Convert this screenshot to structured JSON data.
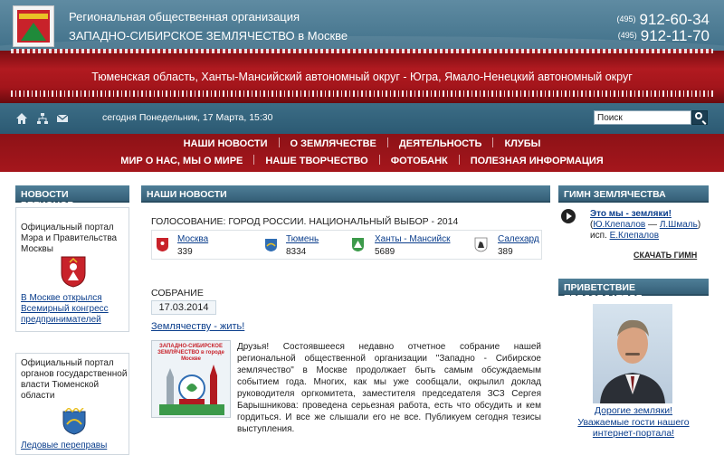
{
  "header": {
    "org_line1": "Региональная общественная организация",
    "org_line2": "ЗАПАДНО-СИБИРСКОЕ ЗЕМЛЯЧЕСТВО в Москве",
    "phone1_code": "(495)",
    "phone1_number": "912-60-34",
    "phone2_code": "(495)",
    "phone2_number": "912-11-70",
    "regions": "Тюменская область, Ханты-Мансийский автономный округ - Югра, Ямало-Ненецкий автономный округ"
  },
  "toolbar": {
    "home_icon": "home-icon",
    "sitemap_icon": "sitemap-icon",
    "mail_icon": "mail-icon",
    "today": "сегодня Понедельник, 17 Марта, 15:30",
    "search_value": "Поиск"
  },
  "nav": {
    "row1": [
      "НАШИ НОВОСТИ",
      "О ЗЕМЛЯЧЕСТВЕ",
      "ДЕЯТЕЛЬНОСТЬ",
      "КЛУБЫ"
    ],
    "row2": [
      "МИР О НАС, МЫ О МИРЕ",
      "НАШЕ ТВОРЧЕСТВО",
      "ФОТОБАНК",
      "ПОЛЕЗНАЯ ИНФОРМАЦИЯ"
    ]
  },
  "left": {
    "title": "НОВОСТИ РЕГИОНОВ",
    "portal1_lines": [
      "Официальный портал",
      "Мэра и Правительства",
      "Москвы"
    ],
    "portal1_news": [
      "В Москве открылся",
      "Всемирный конгресс",
      "предпринимателей"
    ],
    "portal2_lines": [
      "Официальный портал",
      "органов государственной",
      "власти Тюменской",
      "области"
    ],
    "portal2_news": [
      "Ледовые переправы"
    ]
  },
  "center": {
    "title": "НАШИ НОВОСТИ",
    "vote_title": "ГОЛОСОВАНИЕ: ГОРОД РОССИИ. НАЦИОНАЛЬНЫЙ ВЫБОР - 2014",
    "vote": [
      {
        "name": "Москва",
        "count": "339"
      },
      {
        "name": "Тюмень",
        "count": "8334"
      },
      {
        "name": "Ханты - Мансийск",
        "count": "5689"
      },
      {
        "name": "Салехард",
        "count": "389"
      }
    ],
    "meeting_title": "СОБРАНИЕ",
    "meeting_date": "17.03.2014",
    "meeting_link": "Землячеству - жить!",
    "meeting_image_caption": "ЗАПАДНО-СИБИРСКОЕ ЗЕМЛЯЧЕСТВО в городе Москве",
    "meeting_text": "Друзья! Состоявшееся недавно отчетное собрание нашей региональной общественной организации \"Западно - Сибирское землячество\" в Москве продолжает быть самым обсуждаемым событием года. Многих, как мы уже сообщали, окрылил доклад руководителя оргкомитета, заместителя председателя ЗСЗ Сергея Барышникова: проведена серьезная работа, есть что обсудить и кем гордиться. И все же слышали его не все. Публикуем сегодня тезисы выступления."
  },
  "right": {
    "anthem_header": "ГИМН ЗЕМЛЯЧЕСТВА",
    "anthem_title": "Это мы - земляки!",
    "author_music": "Ю.Клепалов",
    "author_lyrics": "Л.Шмаль",
    "performer": "Е.Клепалов",
    "performer_prefix": "исп.",
    "download": "СКАЧАТЬ ГИМН",
    "greeting_header": "ПРИВЕТСТВИЕ ПРЕДСЕДАТЕЛЯ",
    "greeting_line1": "Дорогие земляки!",
    "greeting_line2": "Уважаемые гости нашего интернет-портала!"
  },
  "colors": {
    "header_blue": "#3f6f88",
    "brand_red": "#a5161c",
    "link_blue": "#0b3e8c"
  }
}
